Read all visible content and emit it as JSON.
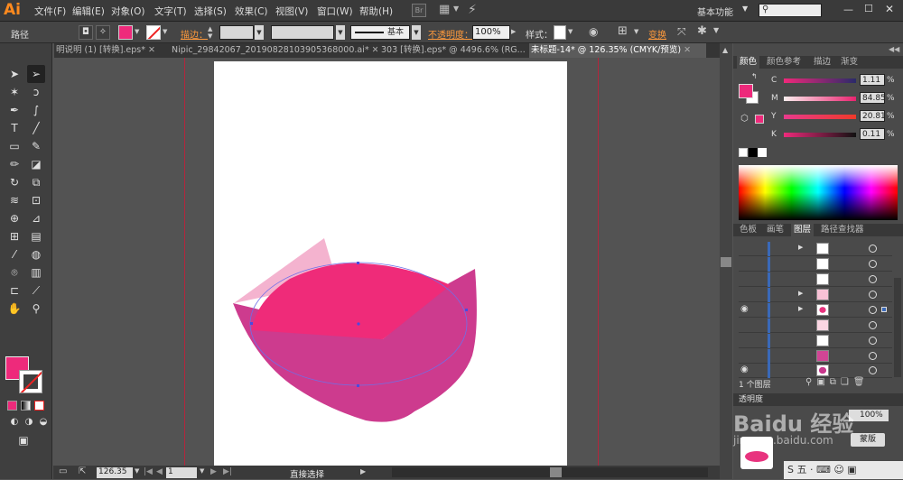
{
  "app": {
    "logo": "Ai",
    "workspace": "基本功能",
    "search_placeholder": ""
  },
  "menu": [
    "文件(F)",
    "编辑(E)",
    "对象(O)",
    "文字(T)",
    "选择(S)",
    "效果(C)",
    "视图(V)",
    "窗口(W)",
    "帮助(H)"
  ],
  "bridge": "Br",
  "window_controls": {
    "min": "—",
    "max": "☐",
    "close": "✕"
  },
  "control": {
    "selection": "路径",
    "stroke_label": "描边：",
    "brush": "基本",
    "opacity_label": "不透明度：",
    "opacity": "100%",
    "style_label": "样式：",
    "transform": "变换"
  },
  "tabs": [
    {
      "label": "明说明 (1) [转换].eps*",
      "close": "✕"
    },
    {
      "label": "Nipic_29842067_20190828103905368000.ai*",
      "close": "✕"
    },
    {
      "label": "303 [转换].eps* @ 4496.6% (RG...",
      "close": "✕"
    },
    {
      "label": "未标题-14* @ 126.35% (CMYK/预览)",
      "close": "✕"
    }
  ],
  "tabs_more": "»",
  "status": {
    "zoom": "126.35",
    "page": "1",
    "tool": "直接选择"
  },
  "color_panel": {
    "tabs": [
      "颜色",
      "颜色参考",
      "描边",
      "渐变"
    ],
    "channels": [
      {
        "label": "C",
        "value": "1.11",
        "pct": "%"
      },
      {
        "label": "M",
        "value": "84.85",
        "pct": "%"
      },
      {
        "label": "Y",
        "value": "20.81",
        "pct": "%"
      },
      {
        "label": "K",
        "value": "0.11",
        "pct": "%"
      }
    ]
  },
  "layers_panel": {
    "tabs": [
      "色板",
      "画笔",
      "图层",
      "路径查找器"
    ],
    "count": "1 个图层"
  },
  "transparency_panel": {
    "title": "透明度",
    "opacity": "100%",
    "mask_button": "蒙版"
  },
  "colors": {
    "fill": "#ee2a7b",
    "dark_pink": "#cd3b8e",
    "pink": "#ef2b79",
    "light_pink": "#f4b3cf",
    "guide": "#b3263c",
    "layer_bar": "#3a69b8"
  },
  "watermark": {
    "line1": "Baidu 经验",
    "line2": "jingyan.baidu.com"
  },
  "taskbar": "S 五 · ⌨ ☺ ▣"
}
